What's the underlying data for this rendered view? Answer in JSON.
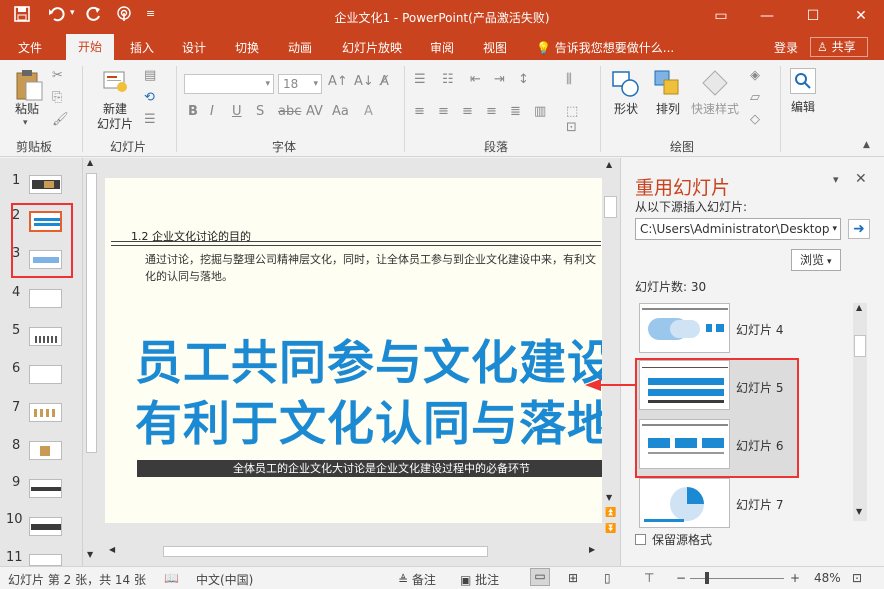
{
  "window": {
    "title": "企业文化1 - PowerPoint(产品激活失败)",
    "minimize": "—",
    "maximize": "☐",
    "close": "✕",
    "ribbon_display": "▭"
  },
  "quick_access": {
    "save_icon": "save-icon",
    "undo_icon": "undo-icon",
    "redo_icon": "redo-icon",
    "touch_icon": "touch-mode-icon",
    "customize_icon": "customize-icon"
  },
  "tabs": {
    "file": "文件",
    "home": "开始",
    "insert": "插入",
    "design": "设计",
    "transitions": "切换",
    "animations": "动画",
    "slideshow": "幻灯片放映",
    "review": "审阅",
    "view": "视图",
    "tellme": "告诉我您想要做什么...",
    "login": "登录",
    "share": "共享"
  },
  "ribbon": {
    "clipboard": {
      "paste": "粘贴",
      "label": "剪贴板"
    },
    "slides": {
      "new_slide_line1": "新建",
      "new_slide_line2": "幻灯片",
      "label": "幻灯片"
    },
    "font": {
      "font_size": "18",
      "label": "字体"
    },
    "paragraph": {
      "label": "段落"
    },
    "drawing": {
      "shape": "形状",
      "arrange": "排列",
      "quick_styles": "快速样式",
      "label": "绘图"
    },
    "editing": {
      "label": "编辑"
    }
  },
  "thumbnails": {
    "numbers": [
      "1",
      "2",
      "3",
      "4",
      "5",
      "6",
      "7",
      "8",
      "9",
      "10",
      "11"
    ]
  },
  "slide": {
    "heading": "1.2  企业文化讨论的目的",
    "body": "通过讨论，挖掘与整理公司精神层文化，同时，让全体员工参与到企业文化建设中来，有利文化的认同与落地。",
    "big_line1": "员工共同参与文化建设",
    "big_line2": "有利于文化认同与落地",
    "band": "全体员工的企业文化大讨论是企业文化建设过程中的必备环节"
  },
  "reuse": {
    "title": "重用幻灯片",
    "source_label": "从以下源插入幻灯片:",
    "path": "C:\\Users\\Administrator\\Desktop",
    "browse": "浏览",
    "count": "幻灯片数: 30",
    "items": [
      "幻灯片 4",
      "幻灯片 5",
      "幻灯片 6",
      "幻灯片 7"
    ],
    "keep_format": "保留源格式",
    "close": "✕"
  },
  "status": {
    "slide_info": "幻灯片 第 2 张，共 14 张",
    "language": "中文(中国)",
    "notes": "备注",
    "comments": "批注",
    "zoom": "48%",
    "zoom_minus": "−",
    "zoom_plus": "+"
  },
  "colors": {
    "accent": "#c9431e",
    "slide_blue": "#1b8ad3",
    "highlight": "#e33333"
  }
}
